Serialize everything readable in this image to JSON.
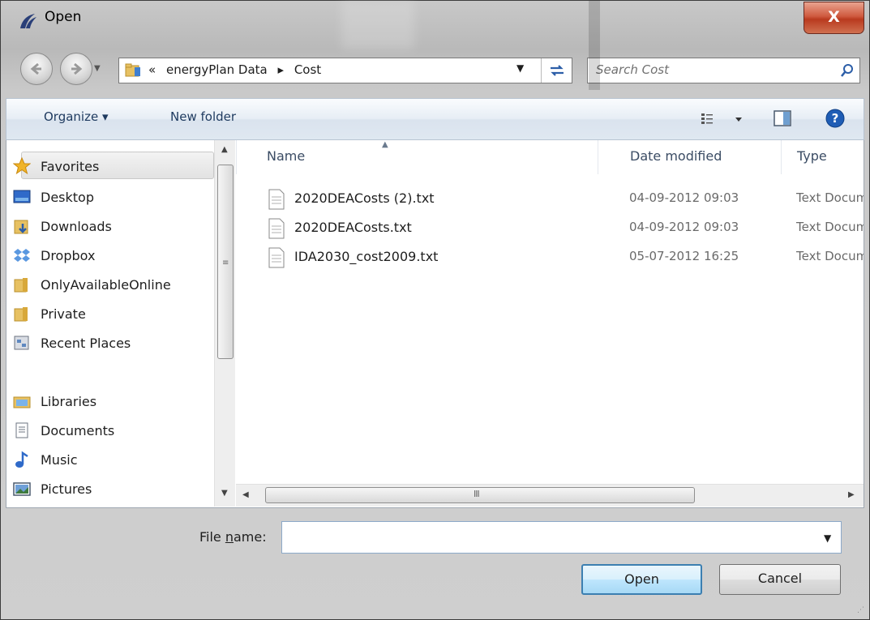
{
  "window": {
    "title": "Open",
    "close_glyph": "X"
  },
  "nav": {
    "breadcrumb": [
      "«",
      "energyPlan Data",
      "▸",
      "Cost"
    ],
    "search_placeholder": "Search Cost"
  },
  "toolbar": {
    "organize": "Organize ▾",
    "new_folder": "New folder"
  },
  "sidebar": {
    "favorites": "Favorites",
    "items": [
      "Desktop",
      "Downloads",
      "Dropbox",
      "OnlyAvailableOnline",
      "Private",
      "Recent Places"
    ],
    "libraries": "Libraries",
    "library_items": [
      "Documents",
      "Music",
      "Pictures"
    ]
  },
  "columns": {
    "name": "Name",
    "date": "Date modified",
    "type": "Type"
  },
  "files": [
    {
      "name": "2020DEACosts (2).txt",
      "date": "04-09-2012 09:03",
      "type": "Text Document"
    },
    {
      "name": "2020DEACosts.txt",
      "date": "04-09-2012 09:03",
      "type": "Text Document"
    },
    {
      "name": "IDA2030_cost2009.txt",
      "date": "05-07-2012 16:25",
      "type": "Text Document"
    }
  ],
  "footer": {
    "file_name_label_pre": "File ",
    "file_name_label_u": "n",
    "file_name_label_post": "ame:",
    "file_name_value": "",
    "open": "Open",
    "cancel": "Cancel"
  },
  "icons": {
    "app": "energyplan-icon",
    "back": "back-arrow-icon",
    "forward": "forward-arrow-icon",
    "folder": "folder-icon",
    "refresh": "refresh-icon",
    "search": "search-icon",
    "views": "views-icon",
    "preview": "preview-pane-icon",
    "help": "help-icon",
    "file": "text-file-icon"
  },
  "colors": {
    "accent": "#3c7fb1",
    "close": "#c9452a",
    "star": "#f0b428",
    "help": "#1f5db5"
  }
}
